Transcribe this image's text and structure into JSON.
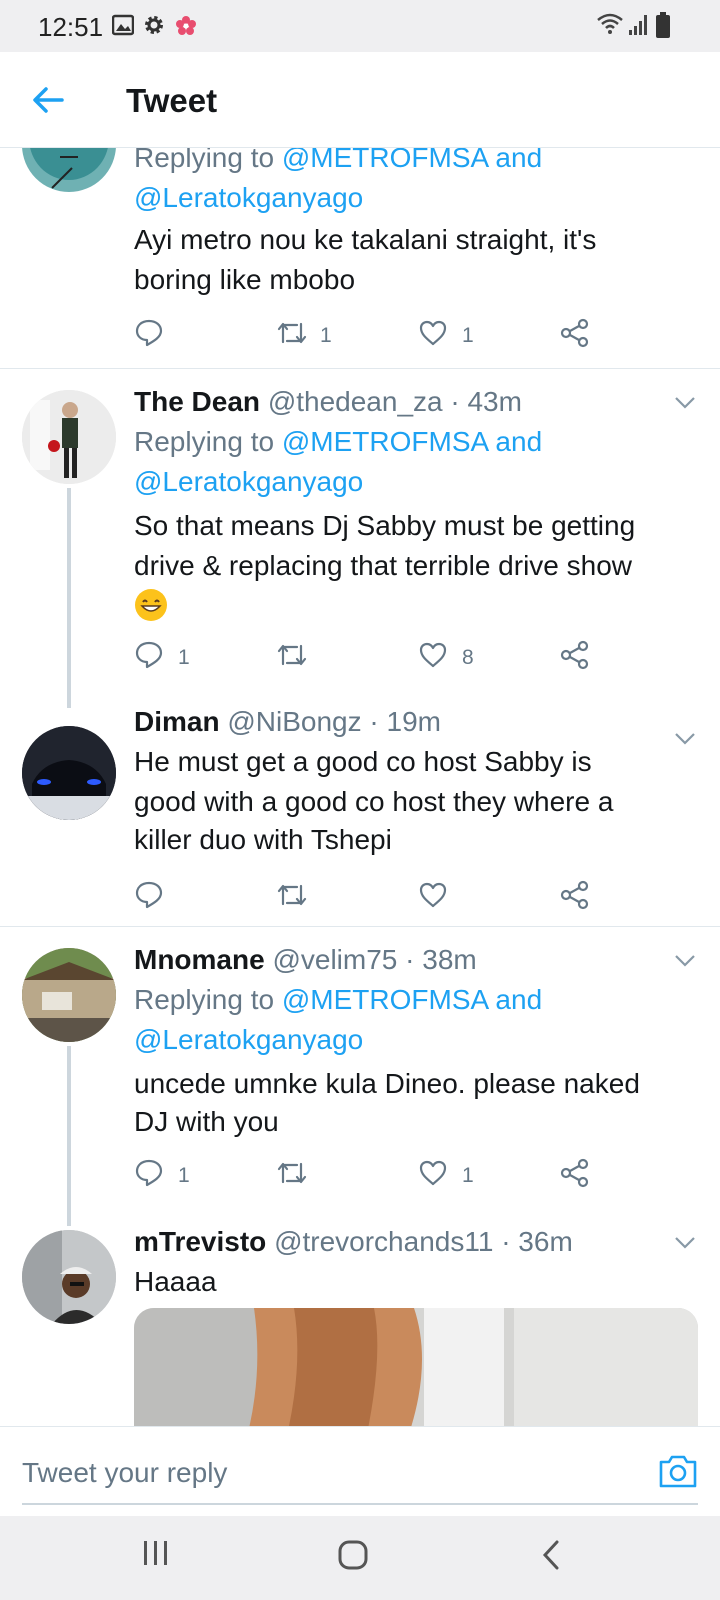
{
  "status_bar": {
    "time": "12:51"
  },
  "header": {
    "title": "Tweet"
  },
  "tweets": [
    {
      "reply_prefix": "Replying to ",
      "mention1": "@METROFMSA",
      "and": " and",
      "mention2": "@Leratokganyago",
      "body_lines": [
        "Ayi metro nou ke takalani straight, it's",
        "boring like mbobo"
      ],
      "replies": "",
      "retweets": "1",
      "likes": "1"
    },
    {
      "name": "The Dean",
      "handle": "@thedean_za",
      "time": "· 43m",
      "reply_prefix": "Replying to ",
      "mention1": "@METROFMSA",
      "and": " and",
      "mention2": "@Leratokganyago",
      "body_lines": [
        "So that means Dj Sabby must be getting",
        "drive & replacing that terrible drive show"
      ],
      "replies": "1",
      "retweets": "",
      "likes": "8"
    },
    {
      "name": "Diman",
      "handle": "@NiBongz",
      "time": "· 19m",
      "body_lines": [
        "He must get a good co host Sabby is",
        "good with a good co host they where a",
        "killer duo with Tshepi"
      ],
      "replies": "",
      "retweets": "",
      "likes": ""
    },
    {
      "name": "Mnomane",
      "handle": "@velim75",
      "time": "· 38m",
      "reply_prefix": "Replying to ",
      "mention1": "@METROFMSA",
      "and": " and",
      "mention2": "@Leratokganyago",
      "body_lines": [
        "uncede umnke kula Dineo. please naked",
        "DJ with you"
      ],
      "replies": "1",
      "retweets": "",
      "likes": "1"
    },
    {
      "name": "mTrevisto",
      "handle": "@trevorchands11",
      "time": "· 36m",
      "body_lines": [
        "Haaaa"
      ]
    }
  ],
  "reply_bar": {
    "placeholder": "Tweet your reply"
  },
  "colors": {
    "accent": "#1da1f2",
    "muted": "#657786",
    "text": "#14171a",
    "divider": "#e1e8ed"
  },
  "icons": [
    "back-arrow-icon",
    "reply-icon",
    "retweet-icon",
    "like-icon",
    "share-icon",
    "chevron-down-icon",
    "camera-icon",
    "wifi-icon",
    "signal-icon",
    "battery-icon"
  ]
}
